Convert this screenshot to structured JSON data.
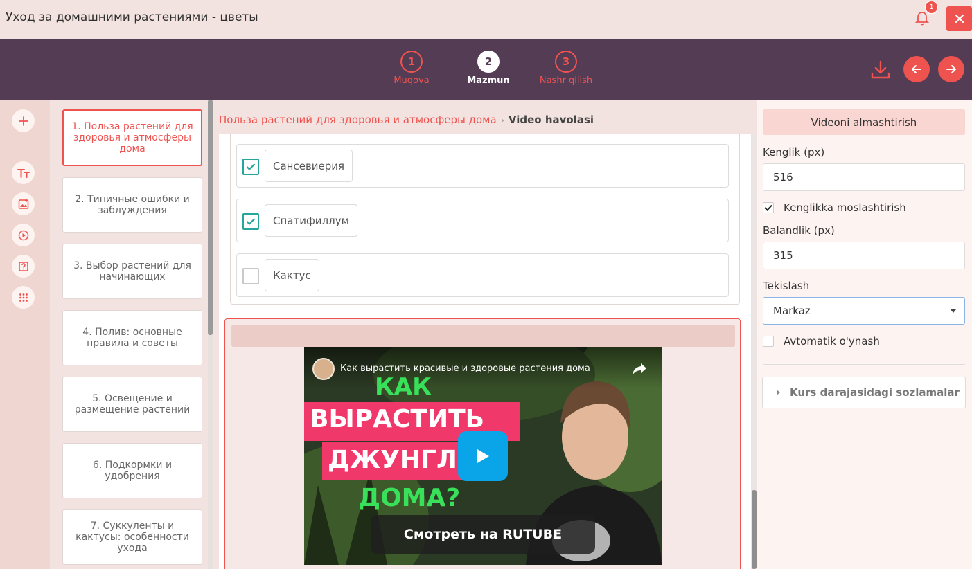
{
  "window": {
    "title": "Уход за домашними растениями - цветы",
    "notification_count": "1"
  },
  "stepper": {
    "steps": [
      {
        "number": "1",
        "label": "Muqova"
      },
      {
        "number": "2",
        "label": "Mazmun"
      },
      {
        "number": "3",
        "label": "Nashr qilish"
      }
    ]
  },
  "pages": [
    {
      "label": "1. Польза растений для здоровья и атмосферы дома"
    },
    {
      "label": "2. Типичные ошибки и заблуждения"
    },
    {
      "label": "3. Выбор растений для начинающих"
    },
    {
      "label": "4. Полив: основные правила и советы"
    },
    {
      "label": "5. Освещение и размещение растений"
    },
    {
      "label": "6. Подкормки и удобрения"
    },
    {
      "label": "7. Суккуленты и кактусы: особенности ухода"
    }
  ],
  "breadcrumb": {
    "parent": "Польза растений для здоровья и атмосферы дома",
    "current": "Video havolasi"
  },
  "answers": [
    {
      "text": "Сансевиерия",
      "checked": true
    },
    {
      "text": "Спатифиллум",
      "checked": true
    },
    {
      "text": "Кактус",
      "checked": false
    }
  ],
  "video": {
    "title": "Как вырастить красивые и здоровые растения дома",
    "line1": "КАК",
    "line2": "ВЫРАСТИТЬ",
    "line3": "ДЖУНГЛИ",
    "line4": "ДОМА?",
    "watch_label": "Смотреть на RUTUBE"
  },
  "settings": {
    "tab_label": "Videoni almashtirish",
    "width_label": "Kenglik (px)",
    "width_value": "516",
    "fit_width_label": "Kenglikka moslashtirish",
    "fit_width_checked": true,
    "height_label": "Balandlik (px)",
    "height_value": "315",
    "align_label": "Tekislash",
    "align_value": "Markaz",
    "autoplay_label": "Avtomatik o'ynash",
    "autoplay_checked": false,
    "course_settings_label": "Kurs darajasidagi sozlamalar"
  },
  "colors": {
    "accent": "#ef5350",
    "header": "#533c54",
    "check": "#26a69a",
    "play": "#0aa5e8"
  }
}
